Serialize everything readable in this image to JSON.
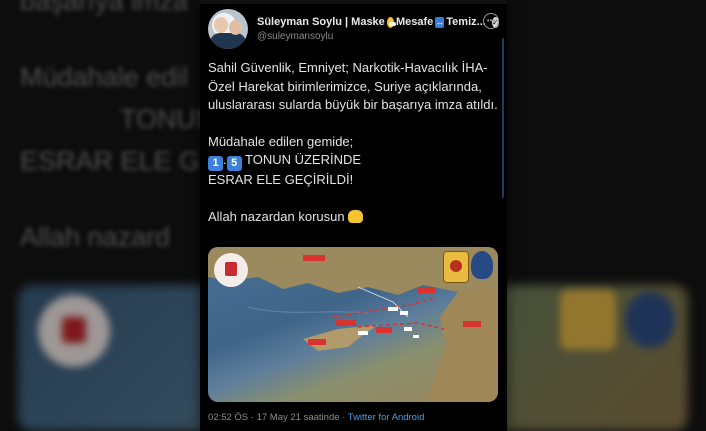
{
  "background": {
    "lines": [
      "başarıya imza",
      "Müdahale edil",
      "TONUN",
      "ESRAR ELE G",
      "Allah nazard"
    ]
  },
  "tweet": {
    "display_name": "Süleyman Soylu | Maske",
    "name_mid": "Mesafe",
    "name_end": "Temiz...",
    "handle": "@suleymansoylu",
    "paragraph1": "Sahil Güvenlik, Emniyet; Narkotik-Havacılık İHA-Özel Harekat birimlerimizce, Suriye açıklarında, uluslararası sularda büyük bir başarıya imza atıldı.",
    "paragraph2_line1": "Müdahale edilen gemide;",
    "keycap1": "1",
    "keycap_sep": ".",
    "keycap2": "5",
    "paragraph2_line2_rest": " TONUN ÜZERİNDE",
    "paragraph2_line3": "ESRAR ELE GEÇİRİLDİ!",
    "paragraph3": "Allah nazardan korusun",
    "time": "02:52 ÖS",
    "sep1": " · ",
    "date": "17 May 21 saatinde",
    "sep2": " · ",
    "source": "Twitter for Android"
  },
  "icons": {
    "verified": "verified-badge-icon",
    "more": "more-options-icon"
  },
  "colors": {
    "card_bg": "#000000",
    "text": "#e3e3e3",
    "secondary": "#8b8b8b",
    "link": "#4a9be6",
    "keycap": "#3e7fd9"
  }
}
